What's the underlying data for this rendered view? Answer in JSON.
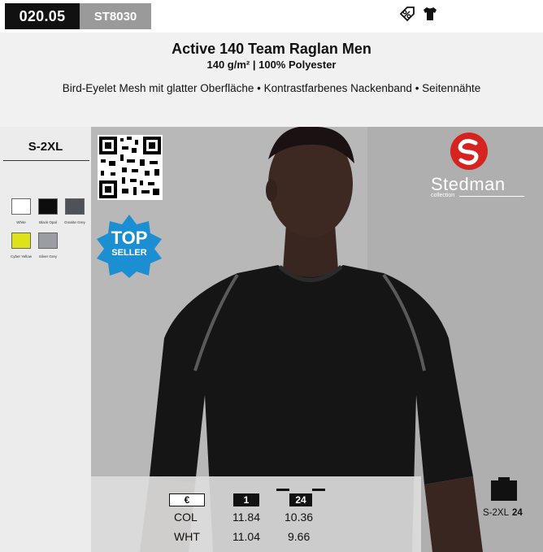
{
  "header": {
    "article_code": "020.05",
    "style_code": "ST8030",
    "title": "Active 140 Team Raglan Men",
    "subtitle": "140 g/m² | 100% Polyester",
    "features": "Bird-Eyelet Mesh mit glatter Oberfläche • Kontrastfarbenes Nackenband • Seitennähte",
    "icons": [
      "discount-percent-icon",
      "tshirt-icon"
    ]
  },
  "sidebar": {
    "sizes": "S-2XL",
    "colors": [
      {
        "name": "White",
        "hex": "#ffffff"
      },
      {
        "name": "Black Opal",
        "hex": "#0d0d0d"
      },
      {
        "name": "Granite Grey",
        "hex": "#4d5358"
      },
      {
        "name": "Cyber Yellow",
        "hex": "#dde21a"
      },
      {
        "name": "Silver Grey",
        "hex": "#9a9da2"
      }
    ]
  },
  "badge": {
    "line1": "TOP",
    "line2": "SELLER",
    "color": "#1c8fd3"
  },
  "brand": {
    "name": "Stedman",
    "sub": "collection",
    "color": "#d6231f"
  },
  "pricing": {
    "currency_label": "€",
    "qty_1": "1",
    "qty_24": "24",
    "rows": [
      {
        "label": "COL",
        "p1": "11.84",
        "p24": "10.36"
      },
      {
        "label": "WHT",
        "p1": "11.04",
        "p24": "9.66"
      }
    ]
  },
  "packaging": {
    "sizes": "S-2XL",
    "qty": "24"
  }
}
